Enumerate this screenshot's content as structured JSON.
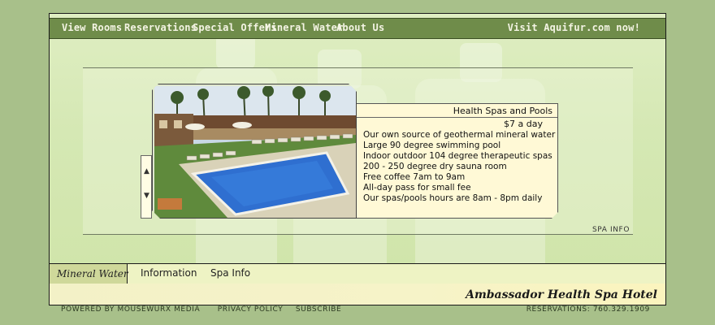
{
  "nav": {
    "view_rooms": "View Rooms",
    "reservations": "Reservations",
    "special_offers": "Special Offers",
    "mineral_water": "Mineral Water",
    "about_us": "About Us",
    "visit": "Visit Aquifur.com now!"
  },
  "panel": {
    "title": "Health Spas and Pools",
    "price": "$7 a day",
    "features": [
      "Our own source of geothermal mineral water",
      "Large 90 degree swimming pool",
      "Indoor outdoor 104 degree therapeutic spas",
      "200 - 250 degree dry sauna room",
      "Free coffee 7am to 9am",
      "All-day pass for small fee",
      "Our spas/pools hours are 8am - 8pm daily"
    ]
  },
  "spa_info_link": "SPA INFO",
  "arrows": {
    "up": "▲",
    "down": "▼"
  },
  "tabs": {
    "mineral_water": "Mineral Water",
    "information": "Information",
    "spa_info": "Spa Info"
  },
  "hotel_name": "Ambassador Health Spa Hotel",
  "footer": {
    "powered_by": "POWERED BY MOUSEWURX MEDIA",
    "privacy": "PRIVACY POLICY",
    "subscribe": "SUBSCRIBE",
    "reservations": "RESERVATIONS: 760.329.1909"
  },
  "colors": {
    "background": "#a8c08a",
    "nav_bar": "#6f8c4a",
    "panel": "#fff9d6",
    "pool": "#2f6fd0"
  }
}
